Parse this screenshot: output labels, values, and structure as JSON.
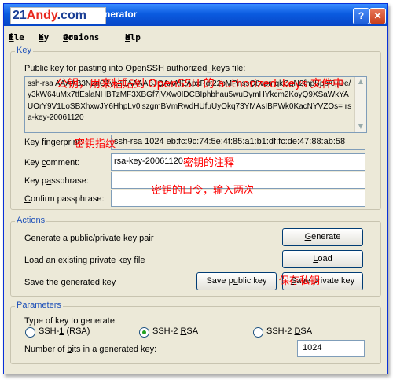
{
  "window": {
    "logo_part1": "21",
    "logo_part2": "Andy",
    "logo_part3": ".com",
    "title": "nerator",
    "help_label": "?",
    "close_label": "✕"
  },
  "menu": [
    {
      "label": "File",
      "shortcut": "F",
      "rest": "ile"
    },
    {
      "label": "Key",
      "shortcut": "K",
      "rest": "ey"
    },
    {
      "label": "Conversions",
      "pre": "Con",
      "shortcut": "v",
      "rest": "ersions"
    },
    {
      "label": "Help",
      "shortcut": "H",
      "rest": "elp"
    }
  ],
  "key_group": {
    "title": "Key",
    "public_key_label": "Public key for pasting into OpenSSH authorized_keys file:",
    "public_key_text": "ssh-rsa AAAAB3NzaC1yc2EAAAABJQAAAIEApxRdt22bMPnssQ8vpmqkQqN2fhpBpb/0jjDe/y3kW64uMx7tfEslaNHBTzMF3XBGf7jVXw0IDCBIphbhau5wuDymHYkcm2KoyQ9XSaWkYAUOrY9V1LoSBXhxwJY6HhpLv0lszgmBVmRwdHUfuUyOkq73YMAsIBPWk0KacNYVZOs= rsa-key-20061120",
    "fingerprint_label": "Key fingerprint:",
    "fingerprint_value": "ssh-rsa 1024 eb:fc:9c:74:5e:4f:85:a1:b1:df:fc:de:47:88:ab:58",
    "comment_label": "Key comment:",
    "comment_value": "rsa-key-20061120",
    "passphrase_label": "Key passphrase:",
    "passphrase_value": "",
    "confirm_label": "Confirm passphrase:",
    "confirm_value": ""
  },
  "actions_group": {
    "title": "Actions",
    "generate_text": "Generate a public/private key pair",
    "generate_button": "Generate",
    "load_text": "Load an existing private key file",
    "load_button": "Load",
    "save_text": "Save the generated key",
    "save_public_button": "Save public key",
    "save_private_button": "Save private key"
  },
  "params_group": {
    "title": "Parameters",
    "type_label": "Type of key to generate:",
    "options": [
      "SSH-1 (RSA)",
      "SSH-2 RSA",
      "SSH-2 DSA"
    ],
    "selected_option": "SSH-2 RSA",
    "bits_label": "Number of bits in a generated key:",
    "bits_value": "1024"
  },
  "annotations": {
    "public_key_note": "公钥，用来粘贴到 OpenSSH 的 authorized_keys 文件中",
    "fingerprint_note": "密钥指纹",
    "comment_note": "密钥的注释",
    "passphrase_note": "密钥的口令，输入两次",
    "save_private_note": "保存私钥"
  },
  "colors": {
    "annotation": "#ff0000",
    "group_title": "#1c4fb8",
    "titlebar": "#0A5BE0",
    "dialog_bg": "#ECE9D8"
  }
}
